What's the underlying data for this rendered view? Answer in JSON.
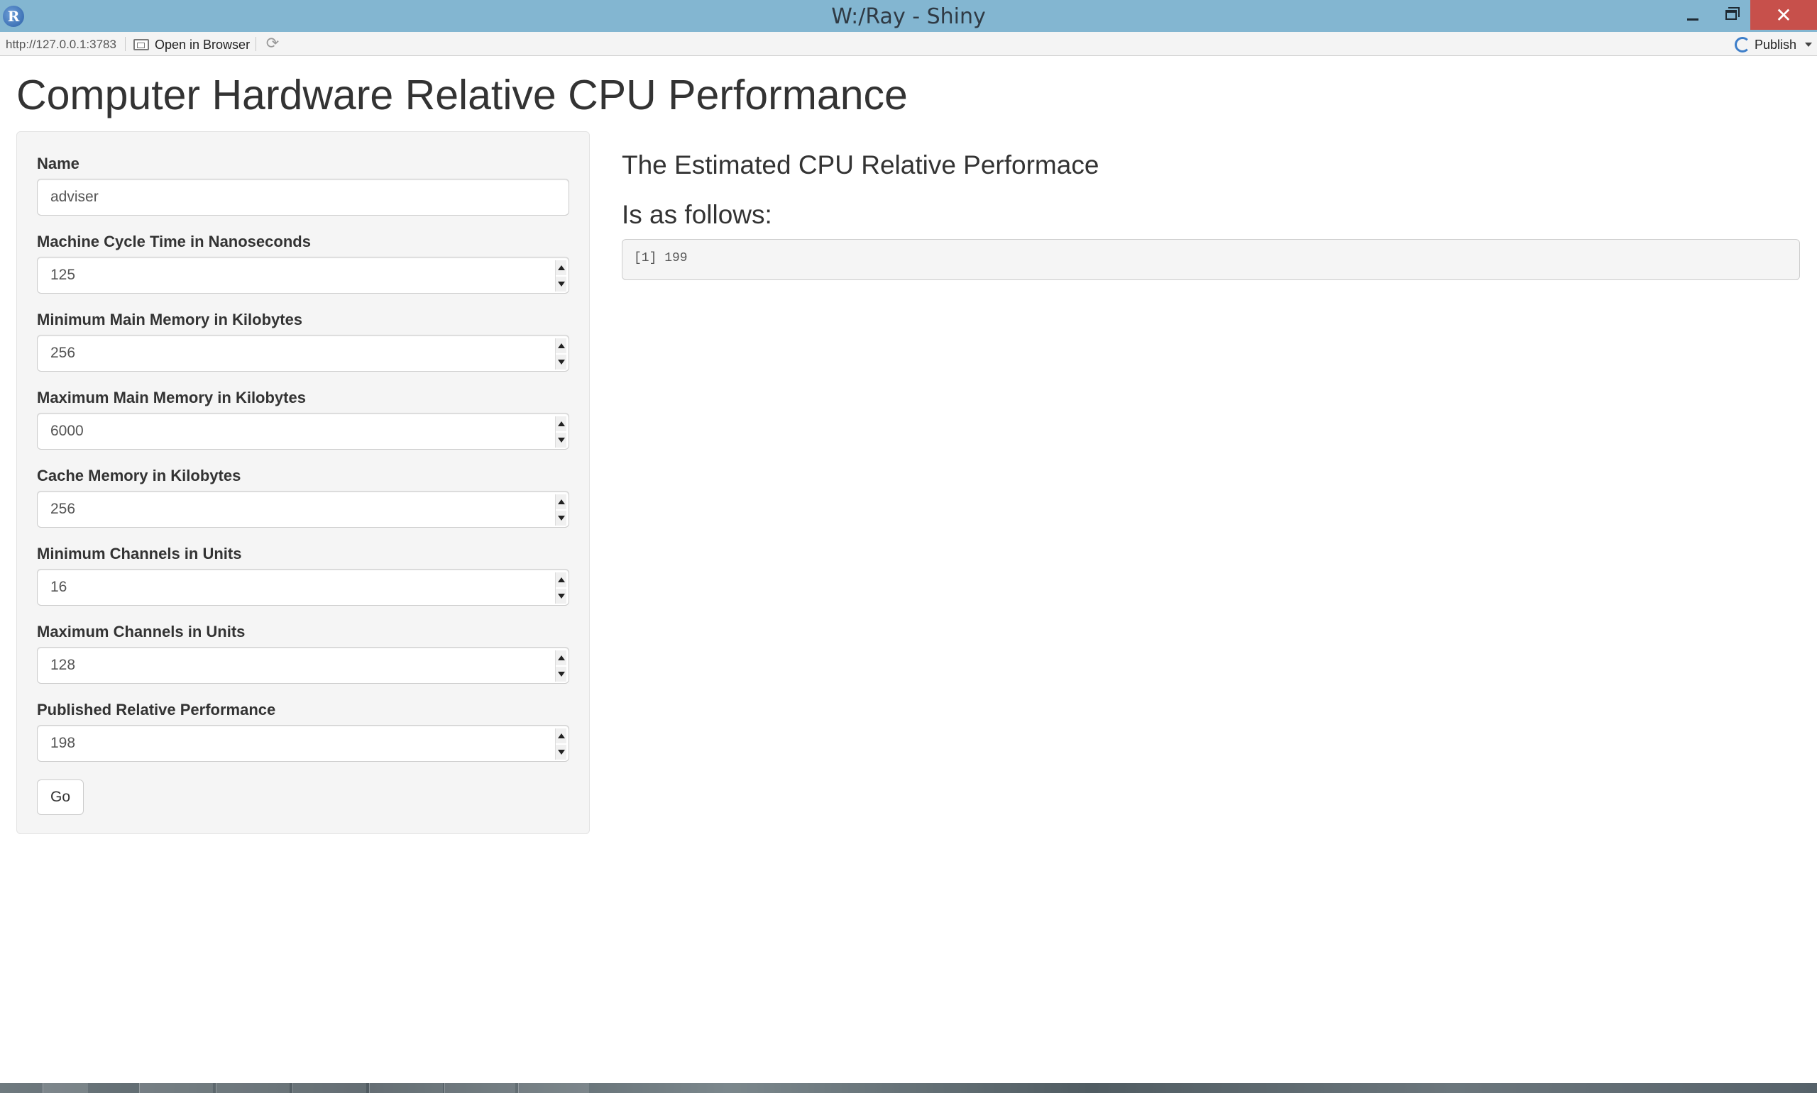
{
  "window": {
    "title": "W:/Ray - Shiny",
    "app_icon_glyph": "R",
    "close_glyph": "✕"
  },
  "toolbar": {
    "url": "http://127.0.0.1:3783",
    "open_in_browser": "Open in Browser",
    "refresh_glyph": "⟳",
    "publish": "Publish"
  },
  "page": {
    "title": "Computer Hardware Relative CPU Performance"
  },
  "form": {
    "name": {
      "label": "Name",
      "value": "adviser"
    },
    "fields": [
      {
        "label": "Machine Cycle Time in Nanoseconds",
        "value": "125"
      },
      {
        "label": "Minimum Main Memory in Kilobytes",
        "value": "256"
      },
      {
        "label": "Maximum Main Memory in Kilobytes",
        "value": "6000"
      },
      {
        "label": "Cache Memory in Kilobytes",
        "value": "256"
      },
      {
        "label": "Minimum Channels in Units",
        "value": "16"
      },
      {
        "label": "Maximum Channels in Units",
        "value": "128"
      },
      {
        "label": "Published Relative Performance",
        "value": "198"
      }
    ],
    "submit_label": "Go"
  },
  "result": {
    "heading": "The Estimated CPU Relative Performace",
    "subheading": "Is as follows:",
    "output": "[1] 199"
  },
  "colors": {
    "titlebar": "#83b6d1",
    "close_button": "#c7504b",
    "well_background": "#f5f5f5"
  }
}
